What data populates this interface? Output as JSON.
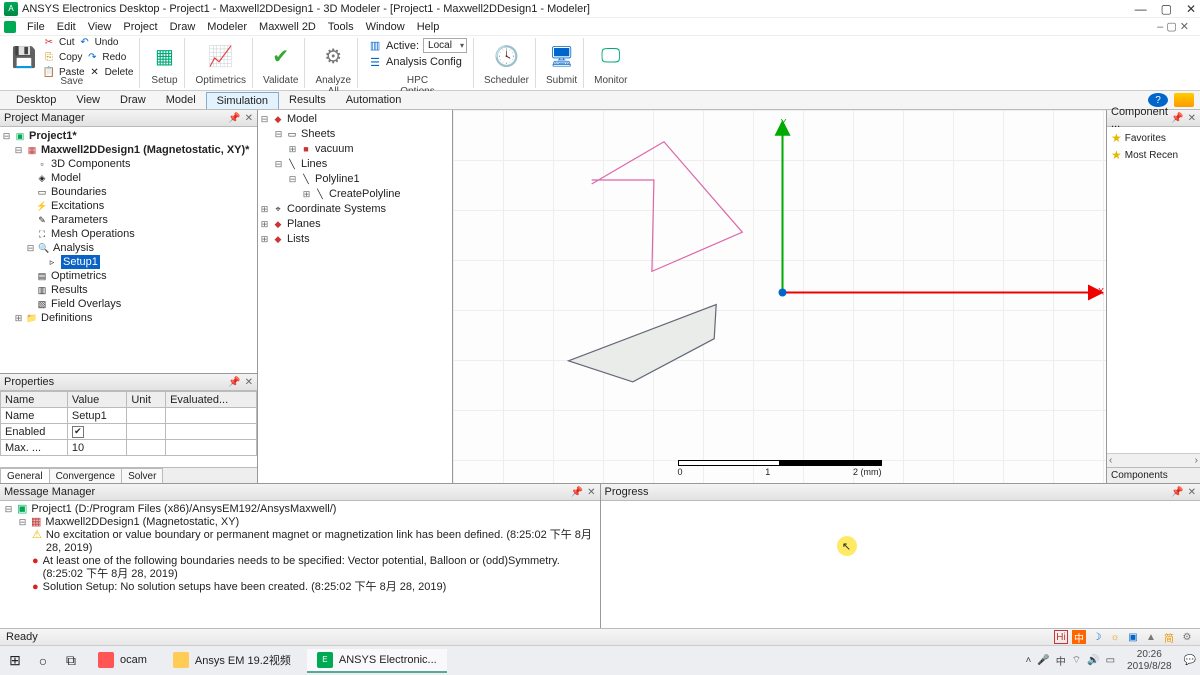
{
  "title": "ANSYS Electronics Desktop - Project1 - Maxwell2DDesign1 - 3D Modeler - [Project1 - Maxwell2DDesign1 - Modeler]",
  "menus": [
    "File",
    "Edit",
    "View",
    "Project",
    "Draw",
    "Modeler",
    "Maxwell 2D",
    "Tools",
    "Window",
    "Help"
  ],
  "ribbon": {
    "save": "Save",
    "clip": {
      "cut": "Cut",
      "copy": "Copy",
      "paste": "Paste",
      "undo": "Undo",
      "redo": "Redo",
      "delete": "Delete"
    },
    "setup": "Setup",
    "optimetrics": "Optimetrics",
    "validate": "Validate",
    "analyze": "Analyze\nAll",
    "hpc": "HPC\nOptions",
    "scheduler": "Scheduler",
    "submit": "Submit",
    "monitor": "Monitor",
    "active_lbl": "Active:",
    "active_val": "Local",
    "analysis_cfg": "Analysis Config"
  },
  "tabs": {
    "items": [
      "Desktop",
      "View",
      "Draw",
      "Model",
      "Simulation",
      "Results",
      "Automation"
    ],
    "active": "Simulation"
  },
  "pm": {
    "title": "Project Manager",
    "root": "Project1*",
    "design": "Maxwell2DDesign1 (Magnetostatic, XY)*",
    "children": [
      "3D Components",
      "Model",
      "Boundaries",
      "Excitations",
      "Parameters",
      "Mesh Operations",
      "Analysis"
    ],
    "setup": "Setup1",
    "after": [
      "Optimetrics",
      "Results",
      "Field Overlays"
    ],
    "defs": "Definitions"
  },
  "props": {
    "title": "Properties",
    "headers": [
      "Name",
      "Value",
      "Unit",
      "Evaluated..."
    ],
    "rows": [
      {
        "n": "Name",
        "v": "Setup1"
      },
      {
        "n": "Enabled",
        "v": "[check]"
      },
      {
        "n": "Max. ...",
        "v": "10"
      }
    ],
    "tabs": [
      "General",
      "Convergence",
      "Solver"
    ]
  },
  "model_tree": {
    "root": "Model",
    "sheets": "Sheets",
    "vacuum": "vacuum",
    "lines": "Lines",
    "polyline": "Polyline1",
    "create": "CreatePolyline",
    "cs": "Coordinate Systems",
    "planes": "Planes",
    "lists": "Lists"
  },
  "right": {
    "title": "Component ...",
    "fav": "Favorites",
    "recent": "Most Recen",
    "tab": "Components"
  },
  "msg": {
    "title": "Message Manager",
    "l1": "Project1 (D:/Program Files (x86)/AnsysEM192/AnsysMaxwell/)",
    "l2": "Maxwell2DDesign1 (Magnetostatic, XY)",
    "l3": "No excitation or value boundary or permanent magnet or magnetization link has been defined. (8:25:02 下午 8月 28, 2019)",
    "l4": "At least one of the following boundaries needs to be specified: Vector potential, Balloon or (odd)Symmetry. (8:25:02 下午  8月 28, 2019)",
    "l5": "Solution Setup: No solution setups have been created. (8:25:02 下午  8月 28, 2019)"
  },
  "progress": {
    "title": "Progress"
  },
  "status": "Ready",
  "scale": {
    "t0": "0",
    "t1": "1",
    "t2": "2 (mm)"
  },
  "tray_icons": [
    "Hi",
    "中",
    "☽",
    "☼",
    "▣",
    "▲",
    "简",
    "⚙"
  ],
  "taskbar": {
    "ocam": "ocam",
    "folder": "Ansys EM 19.2视频",
    "edt": "ANSYS Electronic...",
    "time": "20:26",
    "date": "2019/8/28"
  }
}
